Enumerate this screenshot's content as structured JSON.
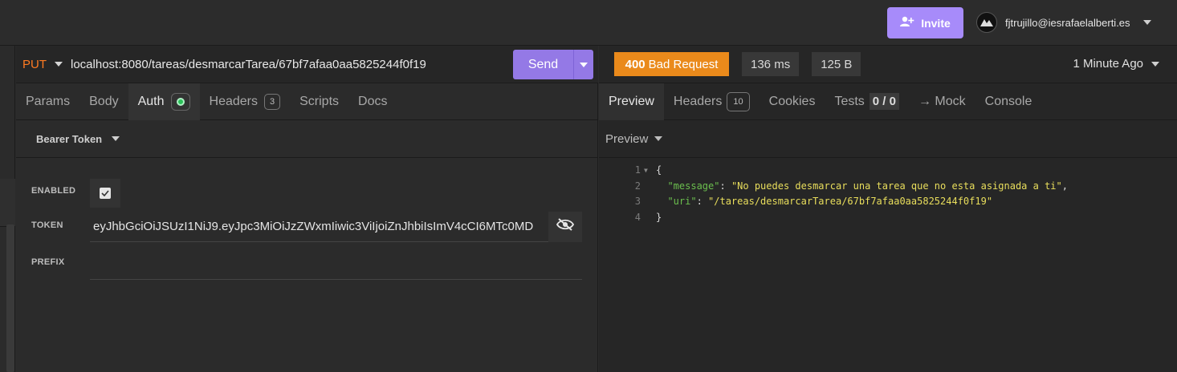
{
  "topbar": {
    "invite_label": "Invite",
    "user_email": "fjtrujillo@iesrafaelalberti.es"
  },
  "request": {
    "method": "PUT",
    "url": "localhost:8080/tareas/desmarcarTarea/67bf7afaa0aa5825244f0f19",
    "send_label": "Send",
    "tabs": {
      "params": "Params",
      "body": "Body",
      "auth": "Auth",
      "headers": "Headers",
      "headers_count": "3",
      "scripts": "Scripts",
      "docs": "Docs"
    },
    "auth": {
      "type": "Bearer Token",
      "enabled_label": "ENABLED",
      "token_label": "TOKEN",
      "prefix_label": "PREFIX",
      "token_value": "eyJhbGciOiJSUzI1NiJ9.eyJpc3MiOiJzZWxmIiwic3ViIjoiZnJhbiIsImV4cCI6MTc0MD",
      "prefix_value": ""
    }
  },
  "response": {
    "status_code": "400",
    "status_text": "Bad Request",
    "time": "136 ms",
    "size": "125 B",
    "ago": "1 Minute Ago",
    "tabs": {
      "preview": "Preview",
      "headers": "Headers",
      "headers_count": "10",
      "cookies": "Cookies",
      "tests": "Tests",
      "tests_count": "0 / 0",
      "mock": "→ Mock",
      "console": "Console"
    },
    "preview_mode": "Preview",
    "body_lines": {
      "l1": {
        "num": "1",
        "text": "{"
      },
      "l2": {
        "num": "2",
        "key": "\"message\"",
        "value": "\"No puedes desmarcar una tarea que no esta asignada a ti\""
      },
      "l3": {
        "num": "3",
        "key": "\"uri\"",
        "value": "\"/tareas/desmarcarTarea/67bf7afaa0aa5825244f0f19\""
      },
      "l4": {
        "num": "4",
        "text": "}"
      }
    }
  }
}
